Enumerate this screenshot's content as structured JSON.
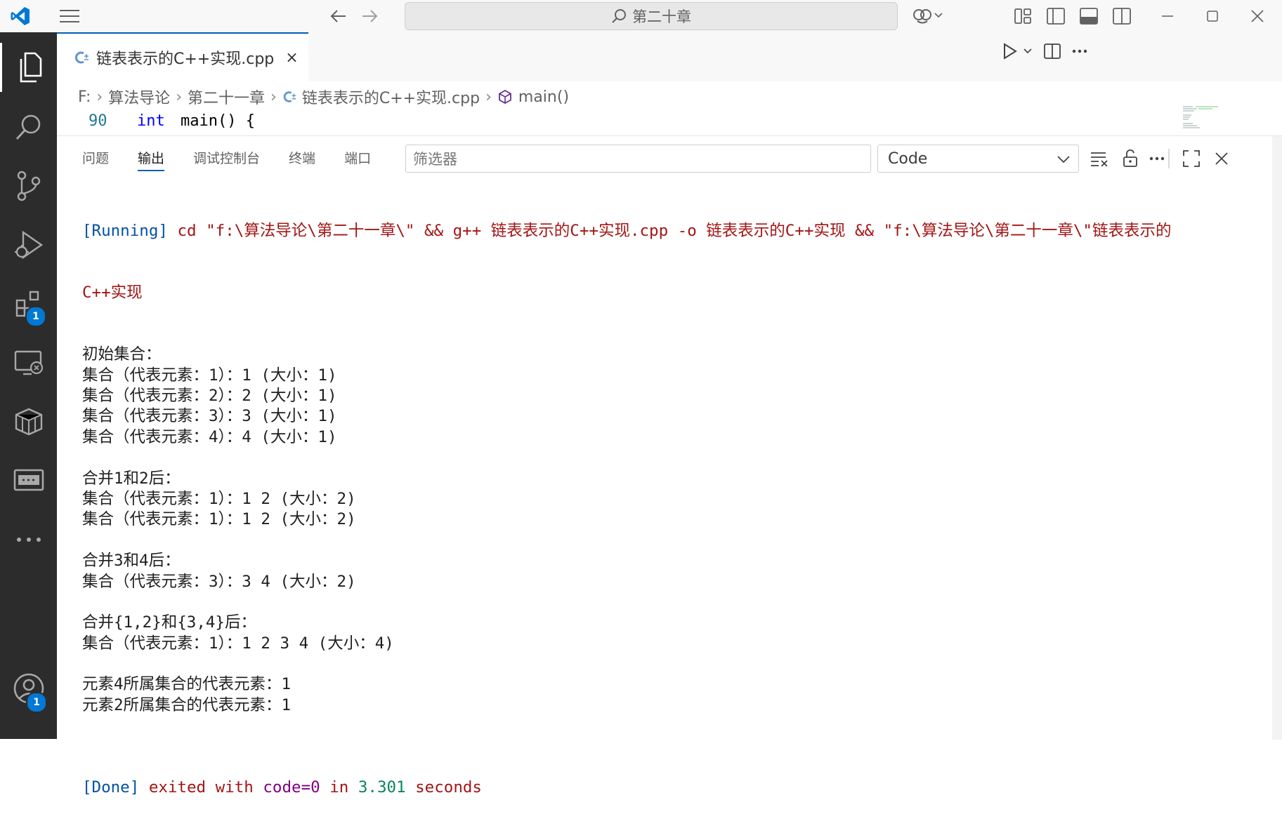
{
  "titlebar": {
    "search_text": "第二十章"
  },
  "activity": {
    "extensions_badge": "1",
    "accounts_badge": "1"
  },
  "tab": {
    "label": "链表表示的C++实现.cpp",
    "close": "×"
  },
  "breadcrumb": {
    "items": [
      "F:",
      "算法导论",
      "第二十一章",
      "链表表示的C++实现.cpp",
      "main()"
    ]
  },
  "editor": {
    "line_number": "90",
    "keyword": "int",
    "code": "main() {"
  },
  "panel": {
    "tabs": [
      "问题",
      "输出",
      "调试控制台",
      "终端",
      "端口"
    ],
    "active_tab": "输出",
    "filter_placeholder": "筛选器",
    "channel": "Code"
  },
  "output": {
    "running_tag": "[Running]",
    "running_cmd_1": " cd \"f:\\算法导论\\第二十一章\\\" && g++ 链表表示的C++实现.cpp -o 链表表示的C++实现 && \"f:\\算法导论\\第二十一章\\\"链表表示的",
    "running_cmd_2": "C++实现",
    "lines": [
      "初始集合：",
      "集合（代表元素：1）：1 (大小：1)",
      "集合（代表元素：2）：2 (大小：1)",
      "集合（代表元素：3）：3 (大小：1)",
      "集合（代表元素：4）：4 (大小：1)",
      "",
      "合并1和2后：",
      "集合（代表元素：1）：1 2 (大小：2)",
      "集合（代表元素：1）：1 2 (大小：2)",
      "",
      "合并3和4后：",
      "集合（代表元素：3）：3 4 (大小：2)",
      "",
      "合并{1,2}和{3,4}后：",
      "集合（代表元素：1）：1 2 3 4 (大小：4)",
      "",
      "元素4所属集合的代表元素：1",
      "元素2所属集合的代表元素：1",
      ""
    ],
    "done_tag": "[Done]",
    "done_1": " exited with ",
    "done_code": "code=0",
    "done_2": " in ",
    "done_time": "3.301",
    "done_3": " seconds"
  },
  "colors": {
    "accent": "#005fb8",
    "activity_bg": "#2c2c2c",
    "badge": "#0078d4",
    "output_blue": "#0451a5",
    "output_red": "#a31515"
  }
}
